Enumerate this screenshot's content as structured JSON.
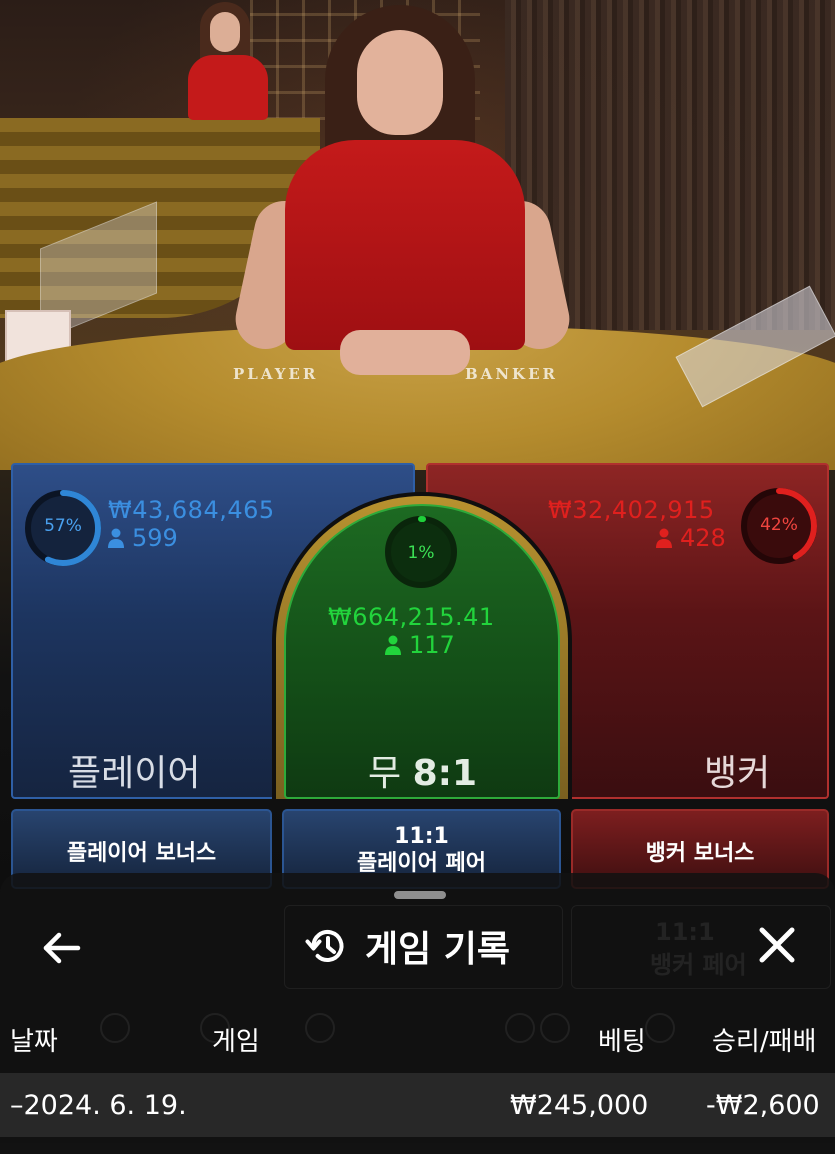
{
  "table_markings": {
    "left": "PLAYER",
    "right": "BANKER"
  },
  "bets": {
    "player": {
      "percent": "57%",
      "amount": "₩43,684,465",
      "players": "599",
      "label": "플레이어",
      "color": "#2f86d6"
    },
    "tie": {
      "percent": "1%",
      "amount": "₩664,215.41",
      "players": "117",
      "label": "무",
      "payout": "8:1",
      "color": "#1fd13a"
    },
    "banker": {
      "percent": "42%",
      "amount": "₩32,402,915",
      "players": "428",
      "label": "뱅커",
      "color": "#e0201e"
    }
  },
  "side_bets": {
    "player_bonus": "플레이어 보너스",
    "player_pair_odds": "11:1",
    "player_pair": "플레이어 페어",
    "banker_bonus": "뱅커 보너스"
  },
  "sheet": {
    "title": "게임 기록",
    "back_icon": "arrow-left-icon",
    "close_icon": "close-icon",
    "title_icon": "history-icon",
    "columns": {
      "date": "날짜",
      "game": "게임",
      "bet": "베팅",
      "result": "승리/패배"
    },
    "rows": [
      {
        "date": "–2024. 6. 19.",
        "bet": "₩245,000",
        "result": "-₩2,600"
      }
    ]
  }
}
